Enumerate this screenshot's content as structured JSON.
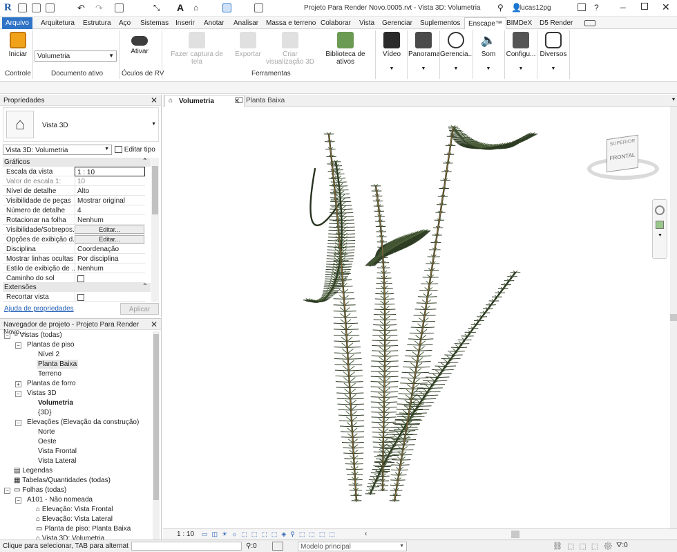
{
  "title_bar": {
    "app_letter": "R",
    "title": "Projeto Para Render Novo.0005.rvt - Vista 3D: Volumetria",
    "user": "lucas12pg"
  },
  "ribbon_tabs": [
    "Arquivo",
    "Arquitetura",
    "Estrutura",
    "Aço",
    "Sistemas",
    "Inserir",
    "Anotar",
    "Analisar",
    "Massa e terreno",
    "Colaborar",
    "Vista",
    "Gerenciar",
    "Suplementos",
    "Enscape™",
    "BIMDeX",
    "D5 Render"
  ],
  "ribbon": {
    "iniciar": "Iniciar",
    "controle": "Controle",
    "doc_value": "Volumetria",
    "doc_label": "Documento ativo",
    "ativar": "Ativar",
    "vr_label": "Óculos de RV",
    "captura": "Fazer captura de tela",
    "exportar": "Exportar",
    "criar_vis": "Criar visualização 3D",
    "biblioteca": "Biblioteca de ativos",
    "ferramentas": "Ferramentas",
    "video": "Vídeo",
    "panorama": "Panorama",
    "gerencia": "Gerencia...",
    "som": "Som",
    "configu": "Configu...",
    "diversos": "Diversos"
  },
  "properties": {
    "title": "Propriedades",
    "type_name": "Vista 3D",
    "selector": "Vista 3D: Volumetria",
    "edit_type": "Editar tipo",
    "section_graficos": "Gráficos",
    "rows": [
      {
        "k": "Escala da vista",
        "v": "1 : 10"
      },
      {
        "k": "Valor de escala    1:",
        "v": "10"
      },
      {
        "k": "Nível de detalhe",
        "v": "Alto"
      },
      {
        "k": "Visibilidade de peças",
        "v": "Mostrar original"
      },
      {
        "k": "Número de detalhe",
        "v": "4"
      },
      {
        "k": "Rotacionar na folha",
        "v": "Nenhum"
      },
      {
        "k": "Visibilidade/Sobrepos...",
        "v": "Editar..."
      },
      {
        "k": "Opções de exibição d...",
        "v": "Editar..."
      },
      {
        "k": "Disciplina",
        "v": "Coordenação"
      },
      {
        "k": "Mostrar linhas ocultas",
        "v": "Por disciplina"
      },
      {
        "k": "Estilo de exibição de ...",
        "v": "Nenhum"
      },
      {
        "k": "Caminho do sol",
        "v": ""
      }
    ],
    "section_extensoes": "Extensões",
    "recortar": "Recortar vista",
    "help_link": "Ajuda de propriedades",
    "apply": "Aplicar"
  },
  "browser": {
    "title": "Navegador de projeto - Projeto Para Render Novo...",
    "nodes": [
      "Vistas (todas)",
      "Plantas de piso",
      "Nível 2",
      "Planta Baixa",
      "Terreno",
      "Plantas de forro",
      "Vistas 3D",
      "Volumetria",
      "{3D}",
      "Elevações (Elevação da construção)",
      "Norte",
      "Oeste",
      "Vista Frontal",
      "Vista Lateral",
      "Legendas",
      "Tabelas/Quantidades (todas)",
      "Folhas (todas)",
      "A101 - Não nomeada",
      "Elevação: Vista Frontal",
      "Elevação: Vista Lateral",
      "Planta de piso: Planta Baixa",
      "Vista 3D: Volumetria"
    ]
  },
  "view_tabs": [
    "Volumetria",
    "Planta Baixa"
  ],
  "viewcube": {
    "face": "FRONTAL",
    "top": "SUPERIOR"
  },
  "view_control": {
    "scale": "1 : 10"
  },
  "status": {
    "hint": "Clique para selecionar, TAB para alternat",
    "count": ":0",
    "model": "Modelo principal",
    "filter": ":0"
  }
}
